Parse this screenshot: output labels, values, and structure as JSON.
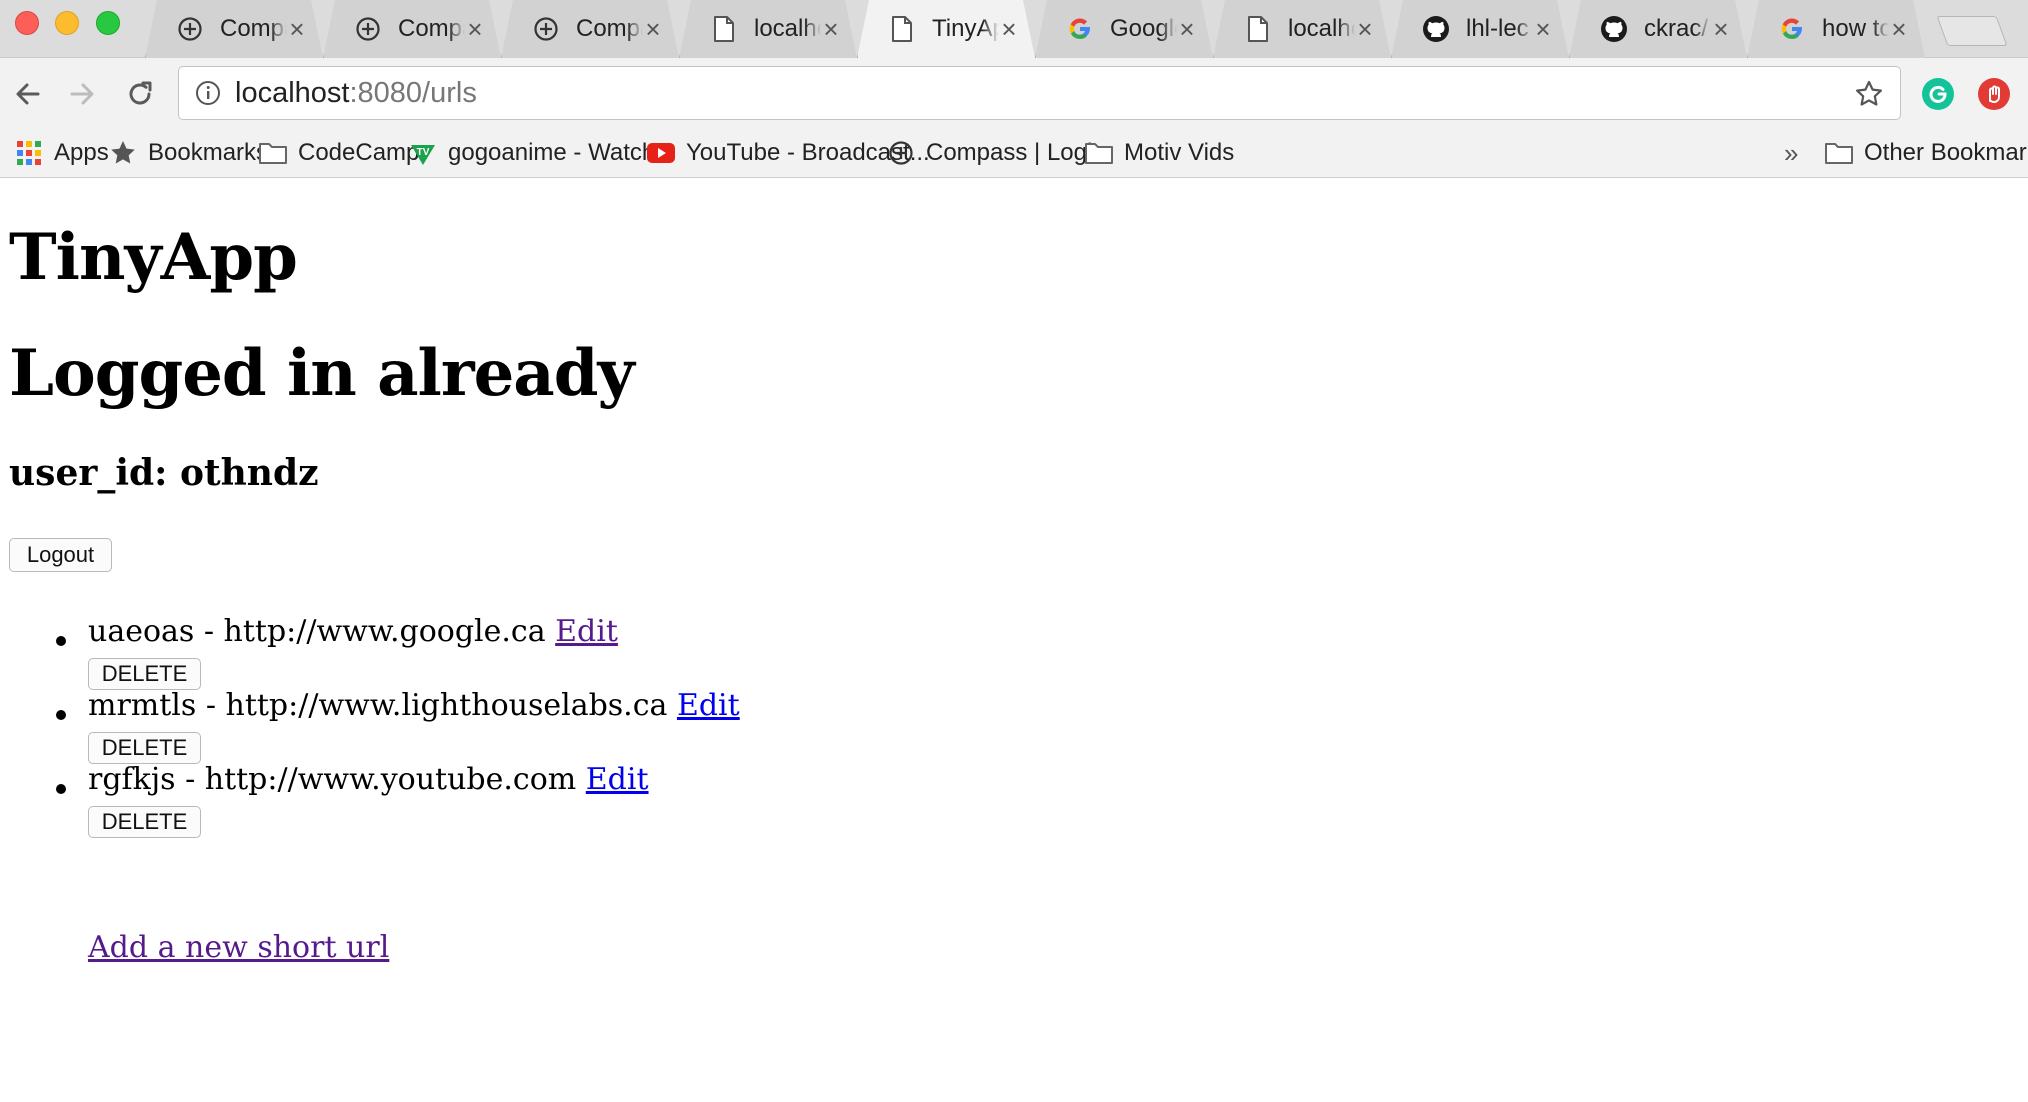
{
  "browser": {
    "tabs": [
      {
        "title": "Compass",
        "icon": "compass-icon",
        "active": false
      },
      {
        "title": "Compass",
        "icon": "compass-icon",
        "active": false
      },
      {
        "title": "Compass",
        "icon": "compass-icon",
        "active": false
      },
      {
        "title": "localhost",
        "icon": "page-icon",
        "active": false
      },
      {
        "title": "TinyApp",
        "icon": "page-icon",
        "active": true
      },
      {
        "title": "Google",
        "icon": "google-icon",
        "active": false
      },
      {
        "title": "localhost",
        "icon": "page-icon",
        "active": false
      },
      {
        "title": "lhl-lec",
        "icon": "github-icon",
        "active": false
      },
      {
        "title": "ckrac/",
        "icon": "github-icon",
        "active": false
      },
      {
        "title": "how to",
        "icon": "google-icon",
        "active": false
      }
    ],
    "address": {
      "host": "localhost",
      "rest": ":8080/urls"
    },
    "bookmarks": [
      {
        "label": "Apps",
        "icon": "apps-grid-icon"
      },
      {
        "label": "Bookmarks",
        "icon": "star-icon"
      },
      {
        "label": "CodeCamp",
        "icon": "folder-icon"
      },
      {
        "label": "gogoanime - Watch...",
        "icon": "tv-icon"
      },
      {
        "label": "YouTube - Broadcast...",
        "icon": "youtube-icon"
      },
      {
        "label": "Compass | Login",
        "icon": "compass-icon"
      },
      {
        "label": "Motiv Vids",
        "icon": "folder-icon"
      }
    ],
    "overflow_label": "»",
    "other_bookmarks": "Other Bookmarks"
  },
  "page": {
    "title": "TinyApp",
    "status": "Logged in already",
    "user_id_text": "user_id: othndz",
    "logout_label": "Logout",
    "urls": [
      {
        "short": "uaeoas",
        "long": "http://www.google.ca",
        "edit_label": "Edit",
        "delete_label": "DELETE",
        "visited": true
      },
      {
        "short": "mrmtls",
        "long": "http://www.lighthouselabs.ca",
        "edit_label": "Edit",
        "delete_label": "DELETE",
        "visited": false
      },
      {
        "short": "rgfkjs",
        "long": "http://www.youtube.com",
        "edit_label": "Edit",
        "delete_label": "DELETE",
        "visited": false
      }
    ],
    "add_link": "Add a new short url"
  },
  "colors": {
    "link": "#0000ee",
    "visited_link": "#551a8b"
  }
}
